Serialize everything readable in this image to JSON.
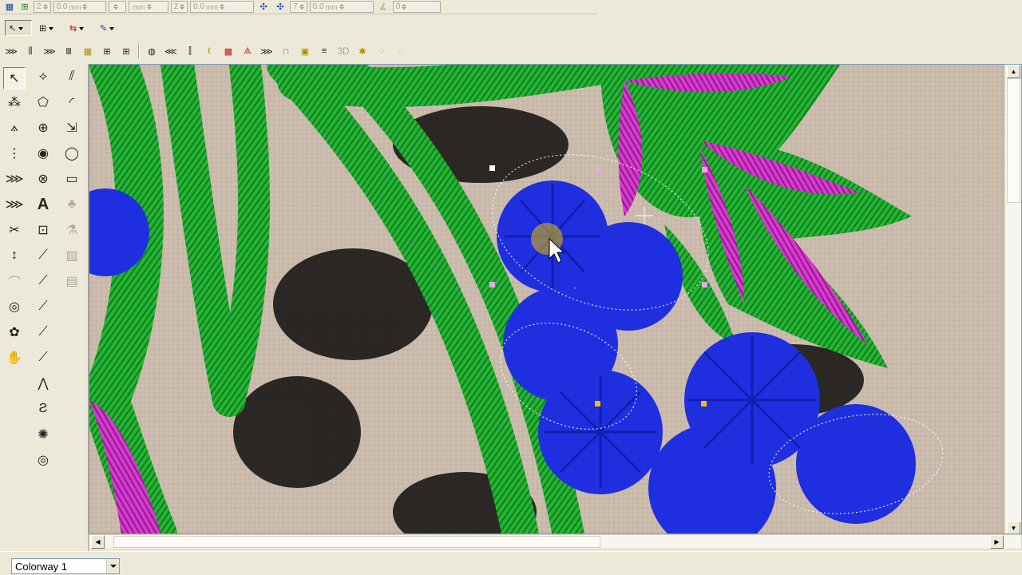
{
  "toolbar_top": {
    "spin_values": [
      "2",
      "0.0",
      "2",
      "0.0",
      "7",
      "0.0",
      "0"
    ],
    "unit": "mm"
  },
  "toolbar_mode": {
    "arrow_glyph": "↖",
    "node_glyph": "⊞",
    "sequence_glyph": "⇆",
    "pen_glyph": "✎"
  },
  "toolbar_stitch": {
    "glyphs": [
      "⋙",
      "⫼",
      "⋙",
      "Ⅲ",
      "▦",
      "⊞",
      "◍",
      "⋘",
      "⫿",
      "ℓ",
      "▩",
      "⟁",
      "⋙",
      "⊓",
      "▣",
      "≡",
      "3D",
      "✱",
      "◌",
      "◌"
    ]
  },
  "toolbox": {
    "glyphs": {
      "select": "↖",
      "reshape": "⟡",
      "line": "⫽",
      "cut": "⁂",
      "polygon": "⬠",
      "arc": "◜",
      "knife": "⟑",
      "rotate": "⊕",
      "scale": "⇲",
      "split": "⋮",
      "digitize": "◉",
      "ellipse": "◯",
      "stitch": "⋙",
      "fill": "⊗",
      "rect": "▭",
      "satin": "⋙",
      "text": "A",
      "stamp": "♣",
      "scissors": "✂",
      "monogram": "⊡",
      "bottle": "⚗",
      "needle": "↕",
      "running": "⟋",
      "pattern": "▨",
      "applique": "⌒",
      "run2": "⟋",
      "grid": "▤",
      "loop": "◎",
      "run3": "⟋",
      "spool": "✿",
      "run4": "⟋",
      "stop": "✋",
      "run5": "⟋",
      "zigzag": "⋀",
      "z2": "Ƨ",
      "star": "✺",
      "target": "◎"
    },
    "text_tool_label": "A",
    "stamp_label": "♣"
  },
  "canvas": {
    "fabric_color": "#c7b7a9",
    "green_thread": "#22b733",
    "green_dark": "#158a22",
    "magenta_thread": "#d63ad2",
    "blue_thread": "#1f2fe0",
    "black_thread": "#1a1716"
  },
  "scrollbars": {
    "up": "▲",
    "down": "▼",
    "left": "◀",
    "right": "▶"
  },
  "status": {
    "colorway": "Colorway 1"
  }
}
